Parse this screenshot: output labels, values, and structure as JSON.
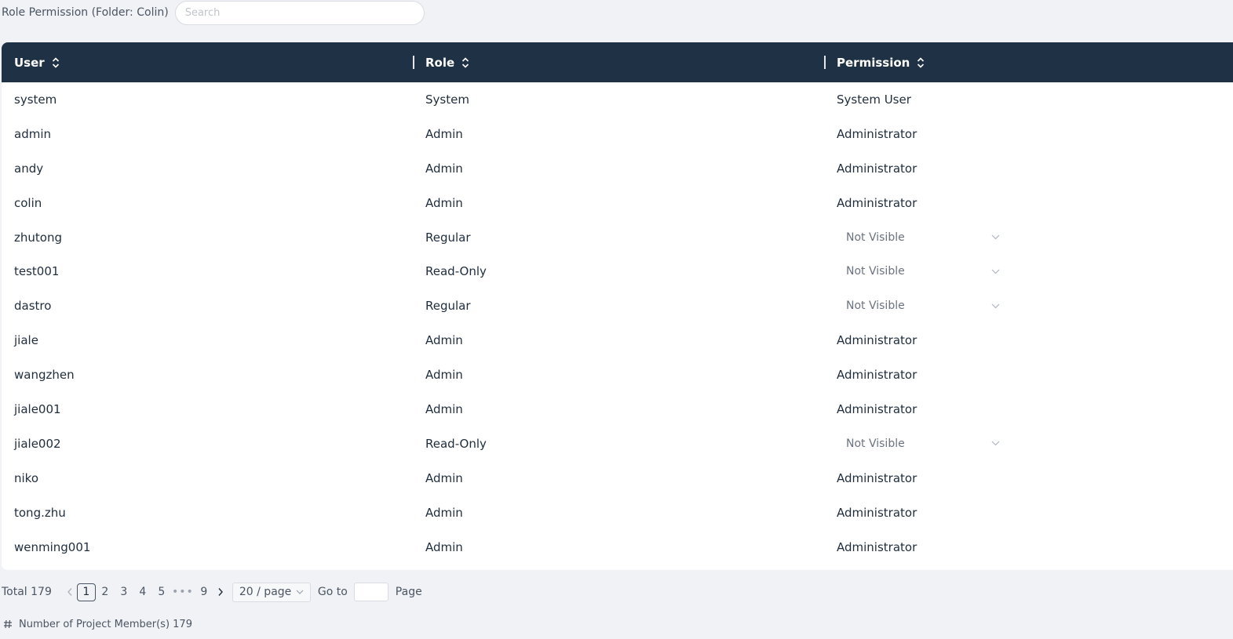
{
  "header": {
    "title": "Role Permission (Folder: Colin)",
    "search_placeholder": "Search"
  },
  "table": {
    "columns": [
      {
        "label": "User"
      },
      {
        "label": "Role"
      },
      {
        "label": "Permission"
      }
    ],
    "rows": [
      {
        "user": "system",
        "role": "System",
        "permission": "System User",
        "dropdown": false
      },
      {
        "user": "admin",
        "role": "Admin",
        "permission": "Administrator",
        "dropdown": false
      },
      {
        "user": "andy",
        "role": "Admin",
        "permission": "Administrator",
        "dropdown": false
      },
      {
        "user": "colin",
        "role": "Admin",
        "permission": "Administrator",
        "dropdown": false
      },
      {
        "user": "zhutong",
        "role": "Regular",
        "permission": "Not Visible",
        "dropdown": true
      },
      {
        "user": "test001",
        "role": "Read-Only",
        "permission": "Not Visible",
        "dropdown": true
      },
      {
        "user": "dastro",
        "role": "Regular",
        "permission": "Not Visible",
        "dropdown": true
      },
      {
        "user": "jiale",
        "role": "Admin",
        "permission": "Administrator",
        "dropdown": false
      },
      {
        "user": "wangzhen",
        "role": "Admin",
        "permission": "Administrator",
        "dropdown": false
      },
      {
        "user": "jiale001",
        "role": "Admin",
        "permission": "Administrator",
        "dropdown": false
      },
      {
        "user": "jiale002",
        "role": "Read-Only",
        "permission": "Not Visible",
        "dropdown": true
      },
      {
        "user": "niko",
        "role": "Admin",
        "permission": "Administrator",
        "dropdown": false
      },
      {
        "user": "tong.zhu",
        "role": "Admin",
        "permission": "Administrator",
        "dropdown": false
      },
      {
        "user": "wenming001",
        "role": "Admin",
        "permission": "Administrator",
        "dropdown": false
      }
    ]
  },
  "pagination": {
    "total_label": "Total 179",
    "pages": [
      "1",
      "2",
      "3",
      "4",
      "5"
    ],
    "ellipsis": "•••",
    "last_page": "9",
    "current_page": "1",
    "page_size_label": "20 / page",
    "goto_label": "Go to",
    "page_label": "Page"
  },
  "footer": {
    "members_label": "Number of Project Member(s) 179"
  },
  "colors": {
    "header_bg": "#1f3144",
    "page_bg": "#f0f2f5"
  }
}
